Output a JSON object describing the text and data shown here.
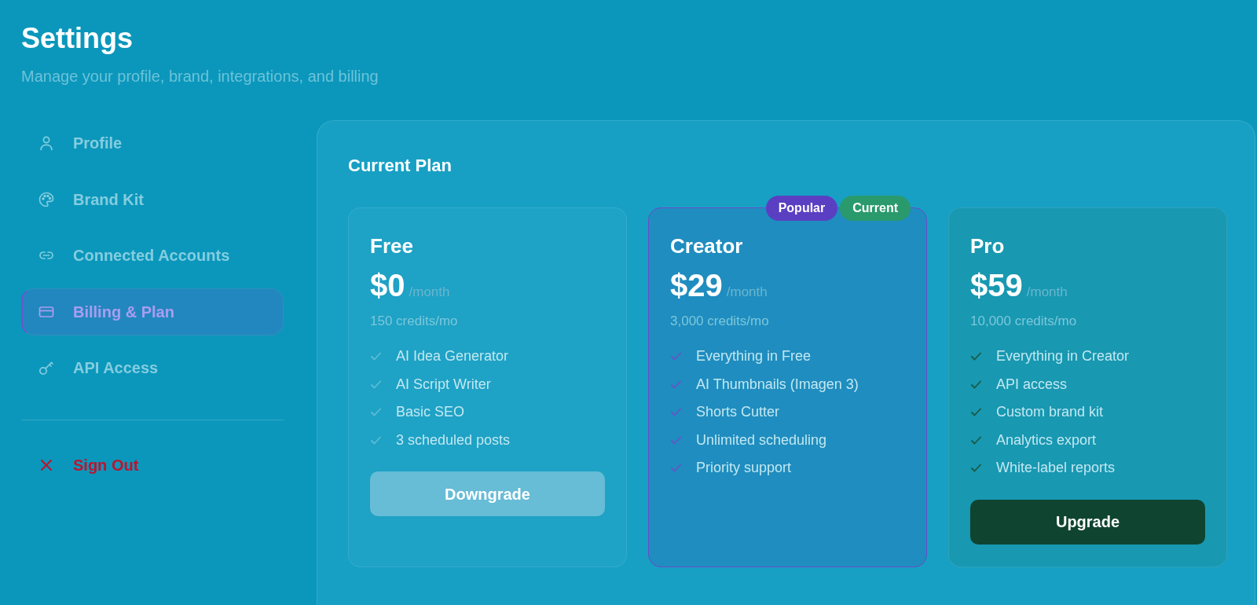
{
  "page": {
    "title": "Settings",
    "subtitle": "Manage your profile, brand, integrations, and billing"
  },
  "sidebar": {
    "items": [
      {
        "label": "Profile",
        "selected": false
      },
      {
        "label": "Brand Kit",
        "selected": false
      },
      {
        "label": "Connected Accounts",
        "selected": false
      },
      {
        "label": "Billing & Plan",
        "selected": true
      },
      {
        "label": "API Access",
        "selected": false
      }
    ],
    "sign_out": {
      "label": "Sign Out"
    }
  },
  "plan_section": {
    "title": "Current Plan",
    "plans": [
      {
        "name": "Free",
        "kind": "basic",
        "selected": false,
        "price": "$0",
        "period": "/month",
        "credits": "150 credits/mo",
        "features": [
          "AI Idea Generator",
          "AI Script Writer",
          "Basic SEO",
          "3 scheduled posts"
        ],
        "button": {
          "label": "Downgrade",
          "kind": "secondary"
        }
      },
      {
        "name": "Creator",
        "kind": "featured",
        "selected": true,
        "badges": [
          {
            "label": "Popular",
            "color": "#5b3fc2"
          },
          {
            "label": "Current",
            "color": "#2a9a6c"
          }
        ],
        "price": "$29",
        "period": "/month",
        "credits": "3,000 credits/mo",
        "features": [
          "Everything in Free",
          "AI Thumbnails (Imagen 3)",
          "Shorts Cutter",
          "Unlimited scheduling",
          "Priority support"
        ]
      },
      {
        "name": "Pro",
        "kind": "premium",
        "selected": false,
        "price": "$59",
        "period": "/month",
        "credits": "10,000 credits/mo",
        "features": [
          "Everything in Creator",
          "API access",
          "Custom brand kit",
          "Analytics export",
          "White-label reports"
        ],
        "button": {
          "label": "Upgrade",
          "kind": "primary"
        }
      }
    ]
  }
}
